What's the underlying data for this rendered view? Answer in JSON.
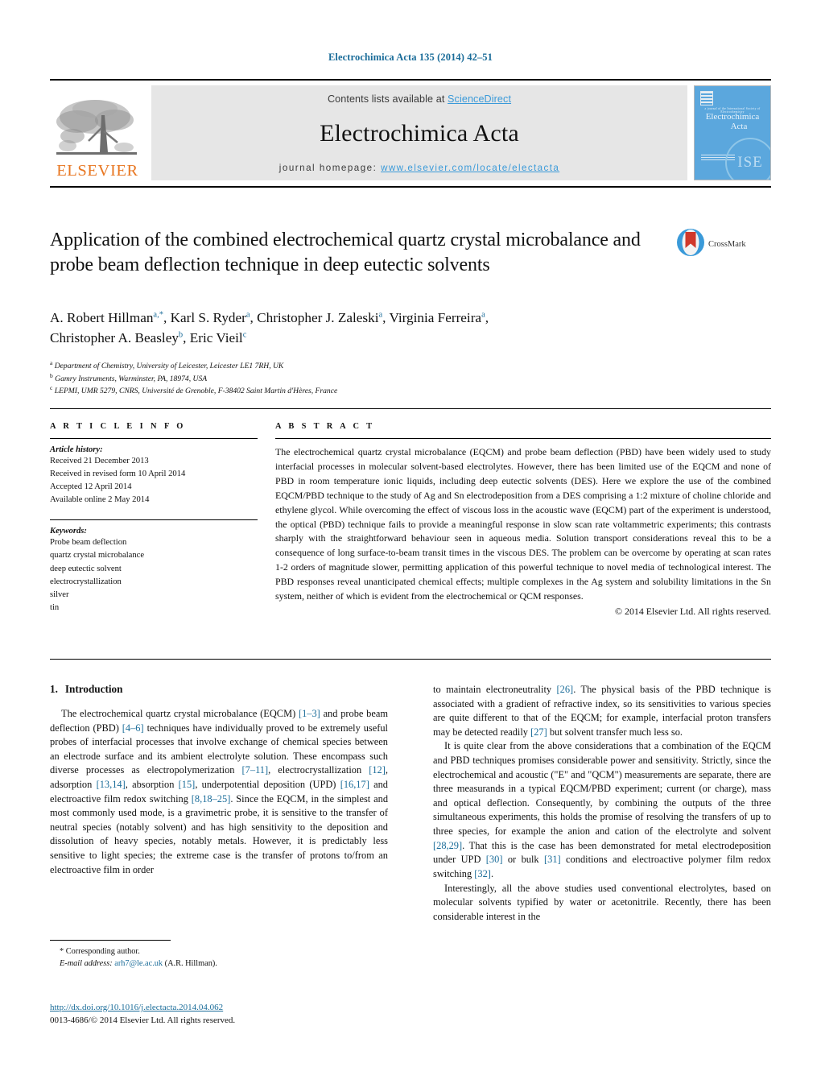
{
  "running_head": "Electrochimica Acta 135 (2014) 42–51",
  "masthead": {
    "contents_prefix": "Contents lists available at ",
    "sciencedirect": "ScienceDirect",
    "journal_title": "Electrochimica Acta",
    "homepage_prefix": "journal homepage: ",
    "homepage_url": "www.elsevier.com/locate/electacta",
    "publisher_logo_text": "ELSEVIER",
    "cover": {
      "subtitle": "a journal of the International Society of Electrochemistry",
      "title_line1": "Electrochimica",
      "title_line2": "Acta",
      "society_mark": "ISE"
    },
    "colors": {
      "link": "#3a9ad9",
      "elsevier_orange": "#E87722",
      "band_gray": "#e6e6e6",
      "cover_blue": "#5ba7dd"
    }
  },
  "article": {
    "title": "Application of the combined electrochemical quartz crystal microbalance and probe beam deflection technique in deep eutectic solvents",
    "crossmark_label": "CrossMark",
    "authors": [
      {
        "name": "A. Robert Hillman",
        "marks": "a,*"
      },
      {
        "name": "Karl S. Ryder",
        "marks": "a"
      },
      {
        "name": "Christopher J. Zaleski",
        "marks": "a"
      },
      {
        "name": "Virginia Ferreira",
        "marks": "a"
      },
      {
        "name": "Christopher A. Beasley",
        "marks": "b"
      },
      {
        "name": "Eric Vieil",
        "marks": "c"
      }
    ],
    "affiliations": [
      {
        "mark": "a",
        "text": "Department of Chemistry, University of Leicester, Leicester LE1 7RH, UK"
      },
      {
        "mark": "b",
        "text": "Gamry Instruments, Warminster, PA, 18974, USA"
      },
      {
        "mark": "c",
        "text": "LEPMI, UMR 5279, CNRS, Université de Grenoble, F-38402 Saint Martin d'Hères, France"
      }
    ]
  },
  "article_info": {
    "heading": "A R T I C L E  I N F O",
    "history_label": "Article history:",
    "history": [
      "Received 21 December 2013",
      "Received in revised form 10 April 2014",
      "Accepted 12 April 2014",
      "Available online 2 May 2014"
    ],
    "keywords_label": "Keywords:",
    "keywords": [
      "Probe beam deflection",
      "quartz crystal microbalance",
      "deep eutectic solvent",
      "electrocrystallization",
      "silver",
      "tin"
    ]
  },
  "abstract": {
    "heading": "A B S T R A C T",
    "text": "The electrochemical quartz crystal microbalance (EQCM) and probe beam deflection (PBD) have been widely used to study interfacial processes in molecular solvent-based electrolytes. However, there has been limited use of the EQCM and none of PBD in room temperature ionic liquids, including deep eutectic solvents (DES). Here we explore the use of the combined EQCM/PBD technique to the study of Ag and Sn electrodeposition from a DES comprising a 1:2 mixture of choline chloride and ethylene glycol. While overcoming the effect of viscous loss in the acoustic wave (EQCM) part of the experiment is understood, the optical (PBD) technique fails to provide a meaningful response in slow scan rate voltammetric experiments; this contrasts sharply with the straightforward behaviour seen in aqueous media. Solution transport considerations reveal this to be a consequence of long surface-to-beam transit times in the viscous DES. The problem can be overcome by operating at scan rates 1-2 orders of magnitude slower, permitting application of this powerful technique to novel media of technological interest. The PBD responses reveal unanticipated chemical effects; multiple complexes in the Ag system and solubility limitations in the Sn system, neither of which is evident from the electrochemical or QCM responses.",
    "copyright": "© 2014 Elsevier Ltd. All rights reserved."
  },
  "introduction": {
    "number": "1.",
    "title": "Introduction",
    "left_paragraphs": [
      "The electrochemical quartz crystal microbalance (EQCM) [1–3] and probe beam deflection (PBD) [4–6] techniques have individually proved to be extremely useful probes of interfacial processes that involve exchange of chemical species between an electrode surface and its ambient electrolyte solution. These encompass such diverse processes as electropolymerization [7–11], electrocrystallization [12], adsorption [13,14], absorption [15], underpotential deposition (UPD) [16,17] and electroactive film redox switching [8,18–25]. Since the EQCM, in the simplest and most commonly used mode, is a gravimetric probe, it is sensitive to the transfer of neutral species (notably solvent) and has high sensitivity to the deposition and dissolution of heavy species, notably metals. However, it is predictably less sensitive to light species; the extreme case is the transfer of protons to/from an electroactive film in order"
    ],
    "right_paragraphs": [
      "to maintain electroneutrality [26]. The physical basis of the PBD technique is associated with a gradient of refractive index, so its sensitivities to various species are quite different to that of the EQCM; for example, interfacial proton transfers may be detected readily [27] but solvent transfer much less so.",
      "It is quite clear from the above considerations that a combination of the EQCM and PBD techniques promises considerable power and sensitivity. Strictly, since the electrochemical and acoustic (\"E\" and \"QCM\") measurements are separate, there are three measurands in a typical EQCM/PBD experiment; current (or charge), mass and optical deflection. Consequently, by combining the outputs of the three simultaneous experiments, this holds the promise of resolving the transfers of up to three species, for example the anion and cation of the electrolyte and solvent [28,29]. That this is the case has been demonstrated for metal electrodeposition under UPD [30] or bulk [31] conditions and electroactive polymer film redox switching [32].",
      "Interestingly, all the above studies used conventional electrolytes, based on molecular solvents typified by water or acetonitrile. Recently, there has been considerable interest in the"
    ]
  },
  "footnote": {
    "corresponding_label": "* Corresponding author.",
    "email_label": "E-mail address:",
    "email": "arh7@le.ac.uk",
    "email_suffix": "(A.R. Hillman)."
  },
  "footer": {
    "doi_url": "http://dx.doi.org/10.1016/j.electacta.2014.04.062",
    "issn_line": "0013-4686/© 2014 Elsevier Ltd. All rights reserved."
  }
}
